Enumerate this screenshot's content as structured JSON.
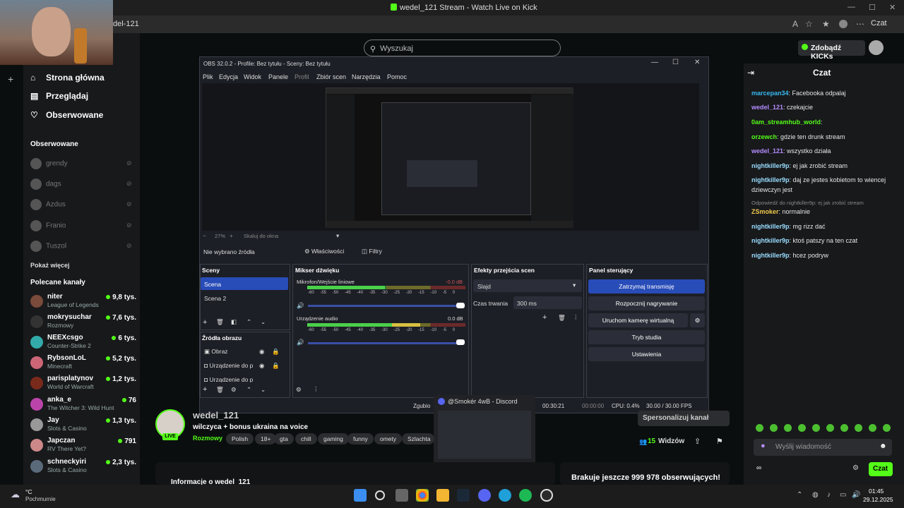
{
  "browser": {
    "title": "wedel_121 Stream - Watch Live on Kick",
    "address": "del-121",
    "czat": "Czat"
  },
  "search": {
    "placeholder": "Wyszukaj"
  },
  "kicks": {
    "label": "Zdobądź KICKs"
  },
  "nav": [
    {
      "label": "Strona główna",
      "icon": "home-icon"
    },
    {
      "label": "Przeglądaj",
      "icon": "browse-icon"
    },
    {
      "label": "Obserwowane",
      "icon": "heart-icon"
    }
  ],
  "followed": {
    "title": "Obserwowane",
    "items": [
      "grendy",
      "dags",
      "Azdus",
      "Franio",
      "Tuszol"
    ],
    "more": "Pokaż więcej"
  },
  "recommended": {
    "title": "Polecane kanały",
    "items": [
      {
        "name": "niter",
        "cat": "League of Legends",
        "viewers": "9,8 tys."
      },
      {
        "name": "mokrysuchar",
        "cat": "Rozmowy",
        "viewers": "7,6 tys."
      },
      {
        "name": "NEEXcsgo",
        "cat": "Counter-Strike 2",
        "viewers": "6 tys."
      },
      {
        "name": "RybsonLoL",
        "cat": "Minecraft",
        "viewers": "5,2 tys."
      },
      {
        "name": "parisplatynov",
        "cat": "World of Warcraft",
        "viewers": "1,2 tys."
      },
      {
        "name": "anka_e",
        "cat": "The Witcher 3: Wild Hunt",
        "viewers": "76"
      },
      {
        "name": "Jay",
        "cat": "Slots & Casino",
        "viewers": "1,3 tys."
      },
      {
        "name": "Japczan",
        "cat": "RV There Yet?",
        "viewers": "791"
      },
      {
        "name": "schneckyiri",
        "cat": "Slots & Casino",
        "viewers": "2,3 tys."
      }
    ]
  },
  "obs": {
    "title": "OBS 32.0.2 - Profile: Bez tytułu - Sceny: Bez tytułu",
    "menu": [
      "Plik",
      "Edycja",
      "Widok",
      "Panele",
      "Profil",
      "Zbiór scen",
      "Narzędzia",
      "Pomoc"
    ],
    "zoom": "27%",
    "scale": "Skaluj do okna",
    "no_source": "Nie wybrano źródła",
    "props": "Właściwości",
    "filters": "Filtry",
    "scenes_title": "Sceny",
    "scenes": [
      "Scena",
      "Scena 2"
    ],
    "sources_title": "Źródła obrazu",
    "sources": [
      "Obraz",
      "Urządzenie do p",
      "Urządzenie do p"
    ],
    "mixer_title": "Mikser dźwięku",
    "mixer": [
      {
        "name": "Mikrofon/Wejście liniowe",
        "db": "-0.0 dB"
      },
      {
        "name": "Urządzenie audio",
        "db": "0.0 dB"
      }
    ],
    "meter_ticks": [
      "-60",
      "-55",
      "-50",
      "-45",
      "-40",
      "-35",
      "-30",
      "-25",
      "-20",
      "-15",
      "-10",
      "-5",
      "0"
    ],
    "transitions_title": "Efekty przejścia scen",
    "transition": "Slajd",
    "duration_label": "Czas trwania",
    "duration": "300 ms",
    "controls_title": "Panel sterujący",
    "controls": [
      "Zatrzymaj transmisję",
      "Rozpocznij nagrywanie",
      "Uruchom kamerę wirtualną",
      "Tryb studia",
      "Ustawienia"
    ],
    "status": {
      "drop": "Zgubio",
      "time1": "00:30:21",
      "time2": "00:00:00",
      "cpu": "CPU: 0.4%",
      "fps": "30.00 / 30.00 FPS"
    }
  },
  "discord": {
    "title": "@Smokér 4wB - Discord"
  },
  "channel": {
    "name": "wedel_121",
    "title": "wilczyca + bonus ukraina na voice",
    "category": "Rozmowy",
    "live": "LIVE",
    "tags": [
      "Polish",
      "18+",
      "gta",
      "chill",
      "gaming",
      "funny",
      "omety",
      "Szlachta"
    ],
    "sponsor": "Spersonalizuj kanał",
    "viewers": "15",
    "viewers_label": "Widzów",
    "info": "Informacje o wedel_121",
    "followers_line": "Brakuje jeszcze 999 978 obserwujących!"
  },
  "chat": {
    "title": "Czat",
    "messages": [
      {
        "user": "marcepan34",
        "text": ": Facebooka odpalaj"
      },
      {
        "user": "wedel_121",
        "text": ": czekajcie"
      },
      {
        "user": "0am_streamhub_world",
        "text": ":"
      },
      {
        "user": "orzewch",
        "text": ": gdzie ten drunk stream"
      },
      {
        "user": "wedel_121",
        "text": ": wszystko działa"
      },
      {
        "user": "nightkiller9p",
        "text": ": ej jak zrobić stream"
      },
      {
        "user": "nightkiller9p",
        "text": ": daj ze jestes kobietom to wiencej dziewczyn jest"
      },
      {
        "user": "ZSmoker",
        "text": ": normalnie"
      },
      {
        "user": "nightkiller9p",
        "text": ": mg rizz dać"
      },
      {
        "user": "nightkiller9p",
        "text": ": ktoś patszy na ten czat"
      },
      {
        "user": "nightkiller9p",
        "text": ": hcez podryw"
      }
    ],
    "reply": "Odpowiedź do nightkiller9p: ej jak zrobić stream",
    "input": "Wyślij wiadomość",
    "send": "Czat"
  },
  "taskbar": {
    "weather": "°C",
    "weather_desc": "Pochmurnie",
    "time": "01:45",
    "date": "29.12.2025"
  }
}
